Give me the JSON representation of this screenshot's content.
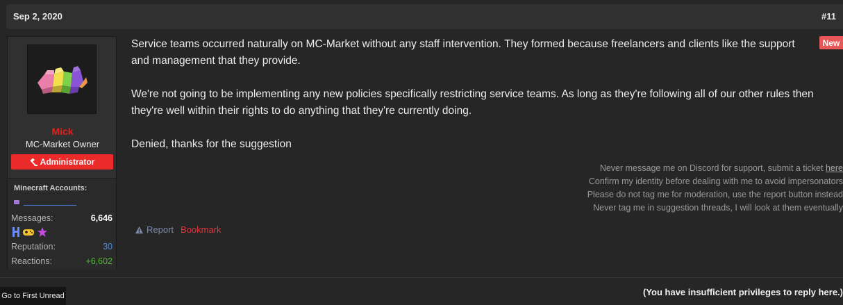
{
  "post": {
    "date": "Sep 2, 2020",
    "number": "#11",
    "new_badge": "New"
  },
  "user": {
    "name": "Mick",
    "title": "MC-Market Owner",
    "role": "Administrator",
    "minecraft_label": "Minecraft Accounts:",
    "stats": {
      "messages_label": "Messages:",
      "messages_value": "6,646",
      "reputation_label": "Reputation:",
      "reputation_value": "30",
      "reactions_label": "Reactions:",
      "reactions_value": "+6,602"
    },
    "colors": {
      "name": "#e0221d",
      "role_badge": "#eb2a2a",
      "reputation": "#4b8ad8",
      "reactions": "#58b63a"
    },
    "trophy_icons": [
      "trophy-blue-icon",
      "gamepad-icon",
      "star-purple-icon"
    ]
  },
  "message": {
    "paragraphs": [
      "Service teams occurred naturally on MC-Market without any staff intervention. They formed because freelancers and clients like the support and management that they provide.",
      "We're not going to be implementing any new policies specifically restricting service teams. As long as they're following all of our other rules then they're well within their rights to do anything that they're currently doing.",
      "Denied, thanks for the suggestion"
    ]
  },
  "signature": {
    "line1_text": "Never message me on Discord for support, submit a ticket ",
    "line1_link": "here",
    "line2": "Confirm my identity before dealing with me to avoid impersonators",
    "line3": "Please do not tag me for moderation, use the report button instead",
    "line4": "Never tag me in suggestion threads, I will look at them eventually"
  },
  "actions": {
    "report": "Report",
    "bookmark": "Bookmark"
  },
  "footer": {
    "go_unread": "Go to First Unread",
    "no_reply": "(You have insufficient privileges to reply here.)"
  }
}
